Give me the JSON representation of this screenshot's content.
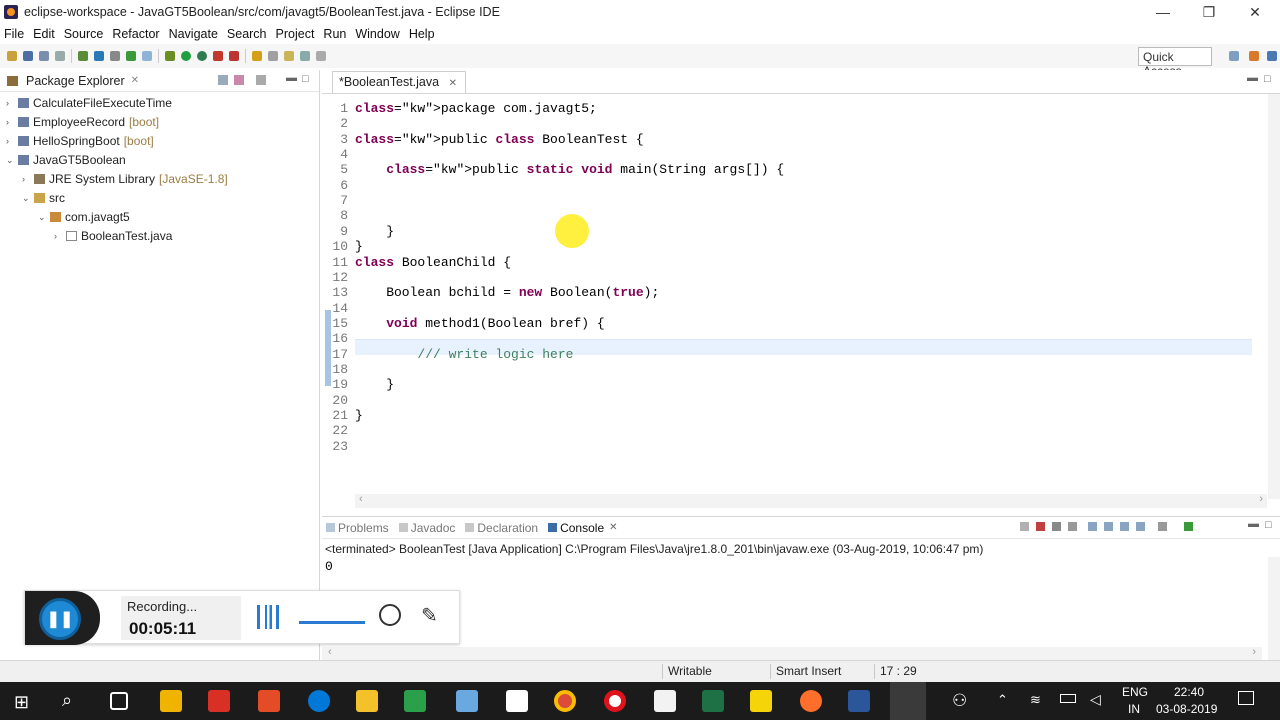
{
  "window": {
    "title": "eclipse-workspace - JavaGT5Boolean/src/com/javagt5/BooleanTest.java - Eclipse IDE",
    "minimize": "—",
    "maximize": "❐",
    "close": "✕"
  },
  "menu": [
    "File",
    "Edit",
    "Source",
    "Refactor",
    "Navigate",
    "Search",
    "Project",
    "Run",
    "Window",
    "Help"
  ],
  "toolbar": {
    "quick_access": "Quick Access"
  },
  "package_explorer": {
    "title": "Package Explorer",
    "items": [
      {
        "label": "CalculateFileExecuteTime",
        "suffix": ""
      },
      {
        "label": "EmployeeRecord",
        "suffix": "[boot]"
      },
      {
        "label": "HelloSpringBoot",
        "suffix": "[boot]"
      },
      {
        "label": "JavaGT5Boolean",
        "suffix": ""
      },
      {
        "label": "JRE System Library",
        "suffix": "[JavaSE-1.8]"
      },
      {
        "label": "src",
        "suffix": ""
      },
      {
        "label": "com.javagt5",
        "suffix": ""
      },
      {
        "label": "BooleanTest.java",
        "suffix": ""
      }
    ]
  },
  "editor": {
    "tab": "*BooleanTest.java",
    "lines": [
      {
        "n": "1",
        "text": "package com.javagt5;"
      },
      {
        "n": "2",
        "text": ""
      },
      {
        "n": "3",
        "text": "public class BooleanTest {"
      },
      {
        "n": "4",
        "text": ""
      },
      {
        "n": "5",
        "text": "    public static void main(String args[]) {"
      },
      {
        "n": "6",
        "text": ""
      },
      {
        "n": "7",
        "text": ""
      },
      {
        "n": "8",
        "text": ""
      },
      {
        "n": "9",
        "text": "    }"
      },
      {
        "n": "10",
        "text": "}"
      },
      {
        "n": "11",
        "text": "class BooleanChild {"
      },
      {
        "n": "12",
        "text": ""
      },
      {
        "n": "13",
        "text": "    Boolean bchild = new Boolean(true);"
      },
      {
        "n": "14",
        "text": ""
      },
      {
        "n": "15",
        "text": "    void method1(Boolean bref) {"
      },
      {
        "n": "16",
        "text": ""
      },
      {
        "n": "17",
        "text": "        /// write logic here"
      },
      {
        "n": "18",
        "text": ""
      },
      {
        "n": "19",
        "text": "    }"
      },
      {
        "n": "20",
        "text": ""
      },
      {
        "n": "21",
        "text": "}"
      },
      {
        "n": "22",
        "text": ""
      },
      {
        "n": "23",
        "text": ""
      }
    ]
  },
  "console": {
    "tabs": [
      "Problems",
      "Javadoc",
      "Declaration",
      "Console"
    ],
    "active_tab": "Console",
    "header": "<terminated> BooleanTest [Java Application] C:\\Program Files\\Java\\jre1.8.0_201\\bin\\javaw.exe (03-Aug-2019, 10:06:47 pm)",
    "output": "0"
  },
  "status": {
    "writable": "Writable",
    "insert_mode": "Smart Insert",
    "position": "17 : 29"
  },
  "recorder": {
    "label": "Recording...",
    "time": "00:05:11"
  },
  "taskbar": {
    "lang": "ENG",
    "region": "IN",
    "time": "22:40",
    "date": "03-08-2019"
  }
}
